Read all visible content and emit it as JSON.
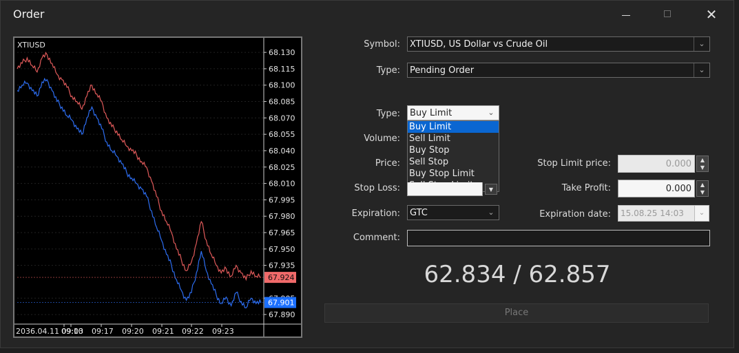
{
  "window": {
    "title": "Order",
    "close_glyph": "✕"
  },
  "chart": {
    "symbol": "XTIUSD",
    "bid_label": "67.924",
    "ask_label": "67.901",
    "colors": {
      "bid": "#e05a5a",
      "ask": "#2d6df0",
      "bid_tag": "#f06a6a",
      "ask_tag": "#1c70ff"
    }
  },
  "chart_data": {
    "type": "line",
    "y_ticks": [
      "68.130",
      "68.115",
      "68.100",
      "68.085",
      "68.070",
      "68.055",
      "68.040",
      "68.025",
      "68.010",
      "67.995",
      "67.980",
      "67.965",
      "67.950",
      "67.935",
      "67.905",
      "67.890"
    ],
    "x_labels": [
      "2036.04.11 09:03",
      "09:10",
      "09:17",
      "09:20",
      "09:21",
      "09:22",
      "09:23"
    ],
    "ylim": [
      67.885,
      68.137
    ],
    "series": [
      {
        "values": [
          68.115,
          68.12,
          68.125,
          68.118,
          68.112,
          68.125,
          68.128,
          68.12,
          68.11,
          68.105,
          68.098,
          68.09,
          68.085,
          68.078,
          68.09,
          68.1,
          68.092,
          68.085,
          68.07,
          68.062,
          68.058,
          68.05,
          68.044,
          68.04,
          68.036,
          68.03,
          68.025,
          68.012,
          67.998,
          67.985,
          67.975,
          67.965,
          67.95,
          67.94,
          67.93,
          67.938,
          67.955,
          67.975,
          67.958,
          67.945,
          67.935,
          67.928,
          67.932,
          67.925,
          67.935,
          67.928,
          67.922,
          67.93,
          67.925,
          67.924
        ]
      },
      {
        "values": [
          68.095,
          68.1,
          68.102,
          68.095,
          68.09,
          68.103,
          68.105,
          68.095,
          68.085,
          68.08,
          68.072,
          68.068,
          68.06,
          68.055,
          68.07,
          68.08,
          68.07,
          68.06,
          68.048,
          68.04,
          68.035,
          68.028,
          68.02,
          68.015,
          68.01,
          68.005,
          67.998,
          67.985,
          67.97,
          67.958,
          67.945,
          67.935,
          67.922,
          67.912,
          67.903,
          67.91,
          67.928,
          67.948,
          67.93,
          67.918,
          67.908,
          67.9,
          67.906,
          67.898,
          67.91,
          67.902,
          67.896,
          67.905,
          67.9,
          67.901
        ]
      }
    ]
  },
  "form": {
    "symbol_label": "Symbol:",
    "symbol_value": "XTIUSD, US Dollar vs Crude Oil",
    "order_type_label": "Type:",
    "order_type_value": "Pending Order",
    "pending_type_label": "Type:",
    "pending_type_value": "Buy Limit",
    "pending_type_options": [
      "Buy Limit",
      "Sell Limit",
      "Buy Stop",
      "Sell Stop",
      "Buy Stop Limit",
      "Sell Stop Limit"
    ],
    "volume_label": "Volume:",
    "price_label": "Price:",
    "stop_loss_label": "Stop Loss:",
    "stop_limit_label": "Stop Limit price:",
    "stop_limit_value": "0.000",
    "take_profit_label": "Take Profit:",
    "take_profit_value": "0.000",
    "expiration_label": "Expiration:",
    "expiration_value": "GTC",
    "expiration_date_label": "Expiration date:",
    "expiration_date_value": "15.08.25 14:03",
    "comment_label": "Comment:",
    "comment_value": ""
  },
  "quote": {
    "text": "62.834 / 62.857"
  },
  "place_button": {
    "label": "Place"
  }
}
